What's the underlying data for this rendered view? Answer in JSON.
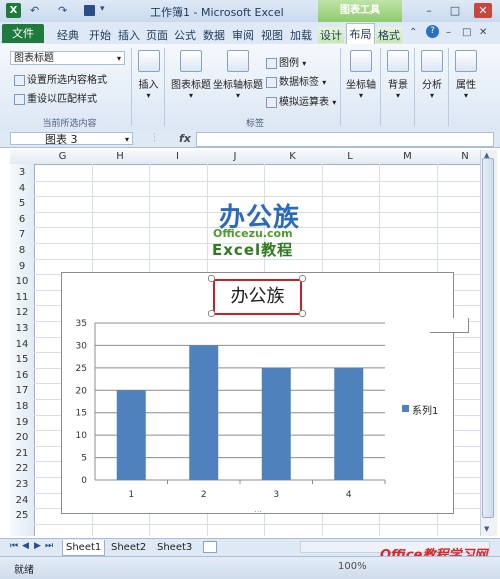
{
  "window": {
    "title": "工作簿1 - Microsoft Excel",
    "app_icon": "X",
    "chart_tools_label": "图表工具",
    "qat_undo": "↶",
    "qat_redo": "↷",
    "minimize": "–",
    "restore": "□",
    "close": "✕"
  },
  "tabs": {
    "file": "文件",
    "items": [
      "经典",
      "开始",
      "插入",
      "页面",
      "公式",
      "数据",
      "审阅",
      "视图",
      "加载",
      "设计"
    ],
    "active": "布局",
    "format": "格式"
  },
  "ribbon": {
    "current_selection": {
      "dropdown_value": "图表标题",
      "format_selection": "设置所选内容格式",
      "reset_style": "重设以匹配样式",
      "group_label": "当前所选内容"
    },
    "insert": {
      "label": "插入"
    },
    "labels_group": {
      "chart_title": "图表标题",
      "axis_titles": "坐标轴标题",
      "legend": "图例",
      "data_labels": "数据标签",
      "data_table": "模拟运算表",
      "group_label": "标签"
    },
    "axes": {
      "label": "坐标轴"
    },
    "background": {
      "label": "背景"
    },
    "analysis": {
      "label": "分析"
    },
    "properties": {
      "label": "属性"
    }
  },
  "formula_bar": {
    "name_box": "图表 3",
    "fx": "fx",
    "value": ""
  },
  "grid": {
    "columns": [
      "G",
      "H",
      "I",
      "J",
      "K",
      "L",
      "M",
      "N"
    ],
    "rows": [
      "3",
      "4",
      "5",
      "6",
      "7",
      "8",
      "9",
      "10",
      "11",
      "12",
      "13",
      "14",
      "15",
      "16",
      "17",
      "18",
      "19",
      "20",
      "21",
      "22",
      "23",
      "24",
      "25"
    ]
  },
  "logo": {
    "name": "办公族",
    "site": "Officezu.com",
    "tagline": "Excel教程"
  },
  "chart_data": {
    "type": "bar",
    "title": "办公族",
    "categories": [
      "1",
      "2",
      "3",
      "4"
    ],
    "series": [
      {
        "name": "系列1",
        "values": [
          20,
          30,
          25,
          25
        ]
      }
    ],
    "ylim": [
      0,
      35
    ],
    "yticks": [
      "0",
      "5",
      "10",
      "15",
      "20",
      "25",
      "30",
      "35"
    ],
    "grid": true,
    "legend_position": "right",
    "bar_color": "#4f81bd"
  },
  "sheets": {
    "tabs": [
      "Sheet1",
      "Sheet2",
      "Sheet3"
    ],
    "active": "Sheet1"
  },
  "status": {
    "ready": "就绪",
    "zoom": "100%"
  },
  "watermark": "Office教程学习网"
}
